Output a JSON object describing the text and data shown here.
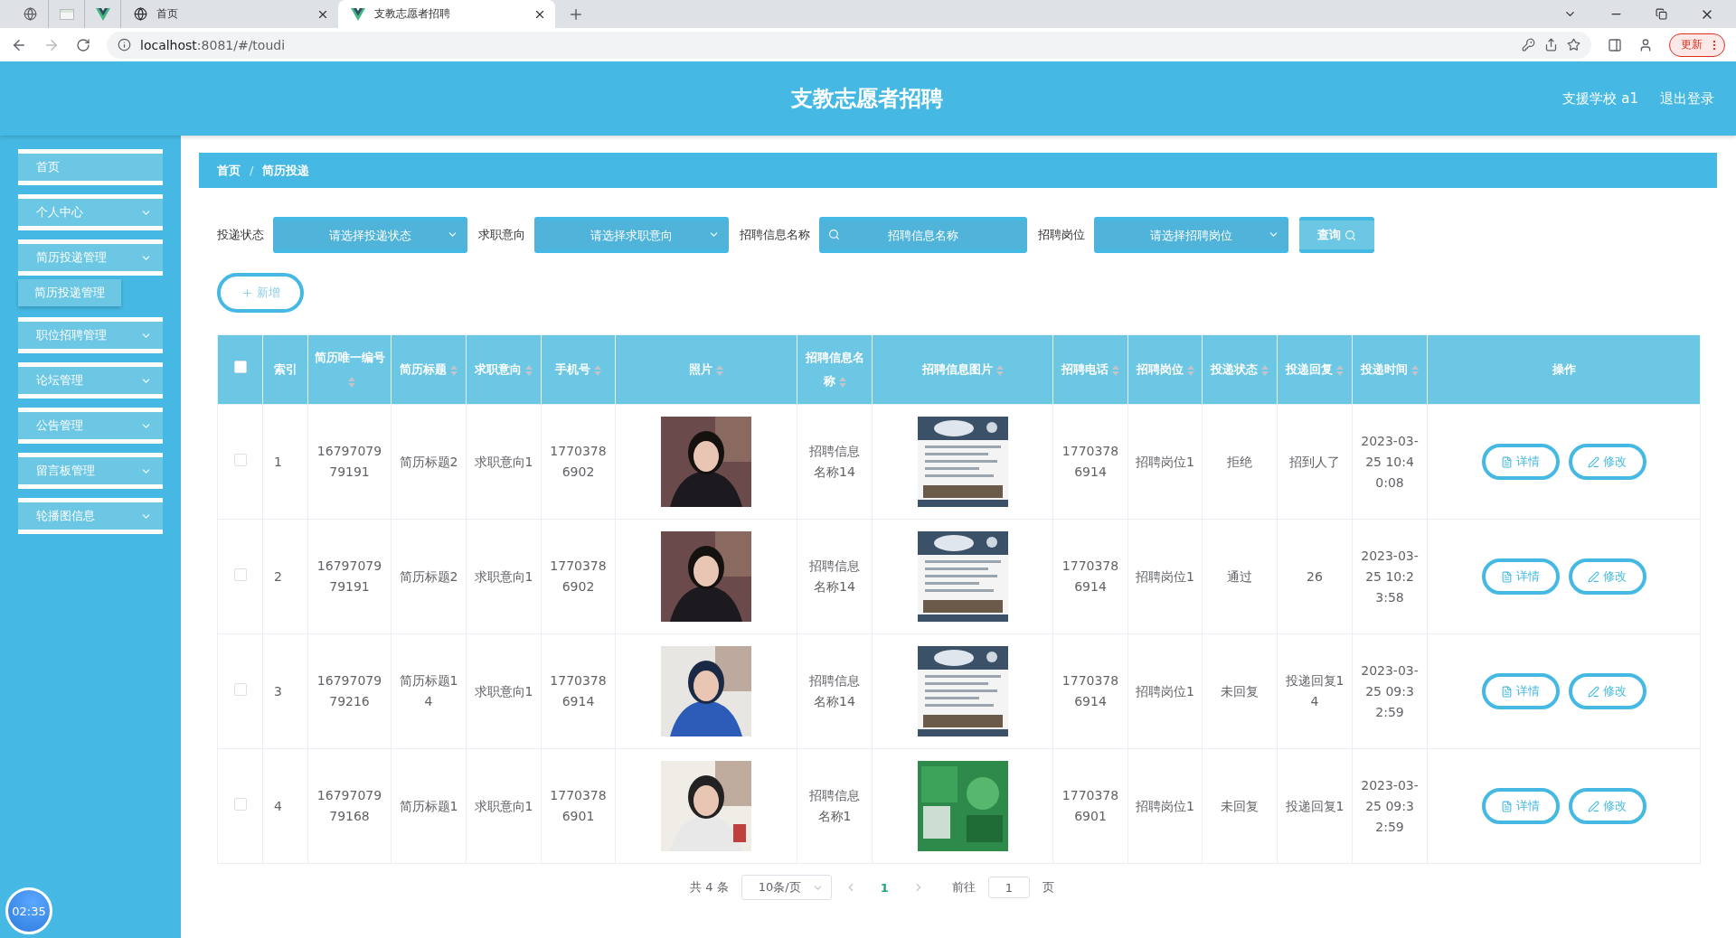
{
  "browser": {
    "tabs": [
      {
        "title": "首页",
        "selected": false
      },
      {
        "title": "支教志愿者招聘",
        "selected": true
      }
    ],
    "url_host": "localhost",
    "url_rest": ":8081/#/toudi",
    "update_button": "更新"
  },
  "header": {
    "title": "支教志愿者招聘",
    "user": "支援学校 a1",
    "logout": "退出登录"
  },
  "sidebar": {
    "items": [
      {
        "label": "首页",
        "kind": "link"
      },
      {
        "label": "个人中心",
        "kind": "menu"
      },
      {
        "label": "简历投递管理",
        "kind": "menu",
        "children": [
          {
            "label": "简历投递管理"
          }
        ]
      },
      {
        "label": "职位招聘管理",
        "kind": "menu"
      },
      {
        "label": "论坛管理",
        "kind": "menu"
      },
      {
        "label": "公告管理",
        "kind": "menu"
      },
      {
        "label": "留言板管理",
        "kind": "menu"
      },
      {
        "label": "轮播图信息",
        "kind": "menu"
      }
    ]
  },
  "breadcrumb": {
    "separator": "/",
    "items": [
      "首页",
      "简历投递"
    ]
  },
  "filters": [
    {
      "label": "投递状态",
      "kind": "select",
      "placeholder": "请选择投递状态"
    },
    {
      "label": "求职意向",
      "kind": "select",
      "placeholder": "请选择求职意向"
    },
    {
      "label": "招聘信息名称",
      "kind": "search",
      "placeholder": "招聘信息名称"
    },
    {
      "label": "招聘岗位",
      "kind": "select",
      "placeholder": "请选择招聘岗位"
    }
  ],
  "query_button": "查询",
  "add_button": "新增",
  "table": {
    "select_all": false,
    "columns": [
      {
        "label": "索引",
        "sortable": false
      },
      {
        "label": "简历唯一编号",
        "sortable": true
      },
      {
        "label": "简历标题",
        "sortable": true
      },
      {
        "label": "求职意向",
        "sortable": true
      },
      {
        "label": "手机号",
        "sortable": true
      },
      {
        "label": "照片",
        "sortable": true
      },
      {
        "label": "招聘信息名称",
        "sortable": true
      },
      {
        "label": "招聘信息图片",
        "sortable": true
      },
      {
        "label": "招聘电话",
        "sortable": true
      },
      {
        "label": "招聘岗位",
        "sortable": true
      },
      {
        "label": "投递状态",
        "sortable": true
      },
      {
        "label": "投递回复",
        "sortable": true
      },
      {
        "label": "投递时间",
        "sortable": true
      },
      {
        "label": "操作",
        "sortable": false
      }
    ],
    "rows": [
      {
        "checked": false,
        "index": "1",
        "id": "1679707979191",
        "title": "简历标题2",
        "intention": "求职意向1",
        "phone": "17703786902",
        "photo": {
          "kind": "picture"
        },
        "info_name": "招聘信息名称14",
        "info_image": {
          "kind": "picture"
        },
        "tel": "17703786914",
        "position": "招聘岗位1",
        "status": "拒绝",
        "reply": "招到人了",
        "time": "2023-03-25 10:40:08",
        "actions": [
          "详情",
          "修改"
        ]
      },
      {
        "checked": false,
        "index": "2",
        "id": "1679707979191",
        "title": "简历标题2",
        "intention": "求职意向1",
        "phone": "17703786902",
        "photo": {
          "kind": "picture"
        },
        "info_name": "招聘信息名称14",
        "info_image": {
          "kind": "picture"
        },
        "tel": "17703786914",
        "position": "招聘岗位1",
        "status": "通过",
        "reply": "26",
        "time": "2023-03-25 10:23:58",
        "actions": [
          "详情",
          "修改"
        ]
      },
      {
        "checked": false,
        "index": "3",
        "id": "1679707979216",
        "title": "简历标题14",
        "intention": "求职意向1",
        "phone": "17703786914",
        "photo": {
          "kind": "picture"
        },
        "info_name": "招聘信息名称14",
        "info_image": {
          "kind": "picture"
        },
        "tel": "17703786914",
        "position": "招聘岗位1",
        "status": "未回复",
        "reply": "投递回复14",
        "time": "2023-03-25 09:32:59",
        "actions": [
          "详情",
          "修改"
        ]
      },
      {
        "checked": false,
        "index": "4",
        "id": "1679707979168",
        "title": "简历标题1",
        "intention": "求职意向1",
        "phone": "17703786901",
        "photo": {
          "kind": "picture"
        },
        "info_name": "招聘信息名称1",
        "info_image": {
          "kind": "picture"
        },
        "tel": "17703786901",
        "position": "招聘岗位1",
        "status": "未回复",
        "reply": "投递回复1",
        "time": "2023-03-25 09:32:59",
        "actions": [
          "详情",
          "修改"
        ]
      }
    ]
  },
  "pagination": {
    "total": "共 4 条",
    "page_size": "10条/页",
    "pages": [
      {
        "label": "1",
        "selected": true
      }
    ],
    "goto_label": "前往",
    "goto_value": "1",
    "goto_suffix": "页"
  },
  "clock": "02:35"
}
